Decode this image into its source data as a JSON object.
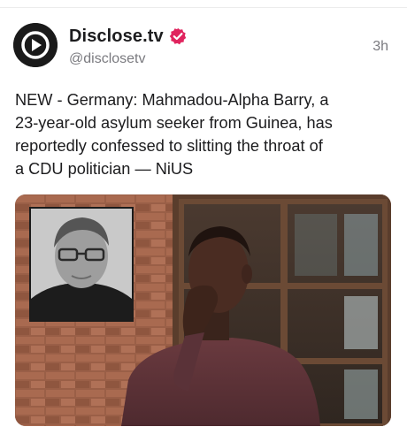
{
  "post": {
    "display_name": "Disclose.tv",
    "handle": "@disclosetv",
    "time": "3h",
    "text": "NEW - Germany: Mahmadou-Alpha Barry, a\n23-year-old asylum seeker from Guinea, has\nreportedly confessed to slitting the throat of\na CDU politician — NiUS",
    "avatar_icon": "play-logo-icon",
    "badge_icon": "verified-badge-icon",
    "badge_color": "#e0245e"
  },
  "colors": {
    "text_primary": "#1c1c1e",
    "text_secondary": "#7a7a7f"
  }
}
